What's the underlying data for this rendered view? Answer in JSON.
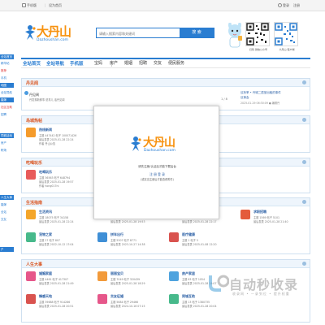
{
  "topbar": {
    "mobile": "手机版",
    "sethome": "设为首页",
    "login": "登录",
    "register": "注册"
  },
  "logo": {
    "cn": "大丹山",
    "en": "Dazhoushan.com"
  },
  "search": {
    "placeholder": "请输入搜索内容和关键词",
    "button": "搜 索"
  },
  "qr": [
    {
      "caption": "扫码 微信公众号"
    },
    {
      "caption": "大丹山 客户端"
    }
  ],
  "nav": {
    "highlight": [
      "全站首页",
      "全站导航",
      "手机版"
    ],
    "items": [
      "宝妈",
      "房产",
      "婚姻",
      "招聘",
      "交友",
      "便民服务"
    ]
  },
  "sidestrip": [
    "全站首页",
    "精华帖",
    "推荐",
    "手机",
    "地图",
    "全站导航",
    "婚嫁",
    "社区互助",
    "招聘",
    "同城活动",
    "房产",
    "职场",
    "人生大事",
    "婚嫁",
    "全站",
    "交友",
    "户"
  ],
  "sections": {
    "s1": {
      "title": "丹见闻"
    },
    "s2": {
      "title": "岛城热帖"
    },
    "s3": {
      "title": "吃喝玩乐"
    },
    "s4": {
      "title": "生活指南"
    },
    "s5": {
      "title": "人生大事"
    }
  },
  "notice": {
    "title": "丹见闻",
    "desc": "丹发现新鲜事 说事儿 话丹见闻",
    "fraction": "1 / 8",
    "last_title": "议析率 • 丹城二居室出租的事件",
    "last_sub": "议事会",
    "last_time": "2025-01-29 06:30:09 ● 编辑丹"
  },
  "forums": {
    "hot": {
      "name": "热线新闻",
      "topics": "主题 447442",
      "posts": "帖子 100071426",
      "last": "最后发表 2025-01-28 22:24",
      "by": "作者 丹山公告"
    },
    "eat": {
      "name": "吃喝玩乐",
      "topics": "主题 36563",
      "posts": "帖子 648794",
      "last": "最后发表 2025-01-28 19:57",
      "by": "作者 hong017ni"
    },
    "life": [
      {
        "name": "生活资讯",
        "topics": "主题 18075",
        "posts": "帖子 34158",
        "last": "最后发表 2025-01-28 22:24"
      },
      {
        "name": "心愿广场",
        "topics": "主题 9",
        "posts": "帖子 9162",
        "last": "最后发表 2025-01-28 19:53"
      },
      {
        "name": "打听咨询",
        "topics": "主题 24113",
        "posts": "帖子 331326",
        "last": "最后发表 2025-01-28 22:17"
      },
      {
        "name": "求职招聘",
        "topics": "主题 1569",
        "posts": "帖子 5101",
        "last": "最后发表 2025-01-28 21:40"
      },
      {
        "name": "宠物之家",
        "topics": "主题 27",
        "posts": "帖子 807",
        "last": "最后发表 2022-10-12 17:04"
      },
      {
        "name": "拼车出行",
        "topics": "主题 5307",
        "posts": "帖子 8771",
        "last": "最后发表 2023-10-27 14:38"
      },
      {
        "name": "医疗健康",
        "topics": "主题 1",
        "posts": "帖子 5",
        "last": "最后发表 2025-01-08 12:20"
      }
    ],
    "events": [
      {
        "name": "婚姻家庭",
        "topics": "主题 4461",
        "posts": "帖子 417307",
        "last": "最后发表 2025-01-28 21:49"
      },
      {
        "name": "丽丽宝贝",
        "topics": "主题 7049",
        "posts": "帖子 320439",
        "last": "最后发表 2025-01-28 18:29"
      },
      {
        "name": "房产家居",
        "topics": "主题 63",
        "posts": "帖子 1054",
        "last": "最后发表 2025-01-28 14:07"
      },
      {
        "name": "情感天地",
        "topics": "主题 39688",
        "posts": "帖子 914286",
        "last": "最后发表 2025-01-28 20:51"
      },
      {
        "name": "交友征婚",
        "topics": "主题 5684",
        "posts": "帖子 29466",
        "last": "最后发表 2024-10-16 07:15"
      },
      {
        "name": "同城互助",
        "topics": "主题 13",
        "posts": "帖子 1380735",
        "last": "最后发表 2025-01-28 20:04"
      }
    ]
  },
  "popup": {
    "logo_cn": "大丹山",
    "logo_en": "Dazhoushan.com",
    "message": "请先注册/认证后才能下载后台",
    "actions": "注 册 登 录",
    "note": "(或实名注册后才能查看附件)"
  },
  "watermark": {
    "big": "自动秒收录",
    "sub": "收录网 • 一录到位 • 提升权重"
  },
  "colors": {
    "accent": "#2a7dd1",
    "brand_orange": "#f7920f",
    "title_red": "#d9531e"
  }
}
